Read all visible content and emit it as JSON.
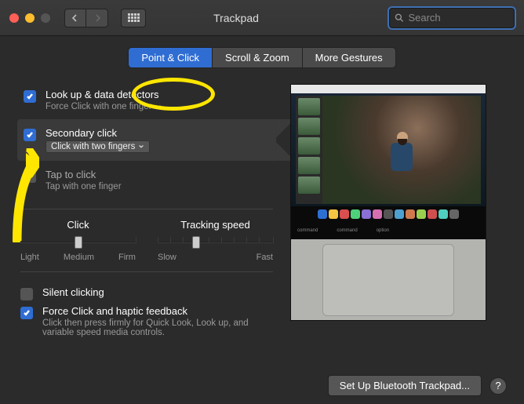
{
  "window": {
    "title": "Trackpad"
  },
  "search": {
    "placeholder": "Search",
    "value": ""
  },
  "tabs": [
    {
      "label": "Point & Click",
      "active": true
    },
    {
      "label": "Scroll & Zoom",
      "active": false
    },
    {
      "label": "More Gestures",
      "active": false
    }
  ],
  "options": {
    "lookup": {
      "title": "Look up & data detectors",
      "sub": "Force Click with one finger",
      "checked": true
    },
    "secondary": {
      "title": "Secondary click",
      "sub": "Click with two fingers",
      "checked": true,
      "selected": true
    },
    "tap": {
      "title": "Tap to click",
      "sub": "Tap with one finger",
      "checked": false
    }
  },
  "sliders": {
    "click": {
      "label": "Click",
      "ticks": [
        "Light",
        "Medium",
        "Firm"
      ],
      "value": 1,
      "count": 3
    },
    "tracking": {
      "label": "Tracking speed",
      "ticks": [
        "Slow",
        "Fast"
      ],
      "value": 3,
      "count": 10
    }
  },
  "bottom": {
    "silent": {
      "title": "Silent clicking",
      "checked": false
    },
    "force": {
      "title": "Force Click and haptic feedback",
      "desc": "Click then press firmly for Quick Look, Look up, and variable speed media controls.",
      "checked": true
    }
  },
  "footer": {
    "bluetooth": "Set Up Bluetooth Trackpad...",
    "help": "?"
  },
  "touchbar": {
    "left": "command",
    "mid": "command",
    "right": "option"
  },
  "dock_colors": [
    "#2e6fd4",
    "#f4c542",
    "#d94e4e",
    "#4ecf7a",
    "#8a6fd4",
    "#d46fb0",
    "#555",
    "#4ea0cf",
    "#cf7a4e",
    "#9acf4e",
    "#cf4e4e",
    "#4ecfc0",
    "#666"
  ]
}
